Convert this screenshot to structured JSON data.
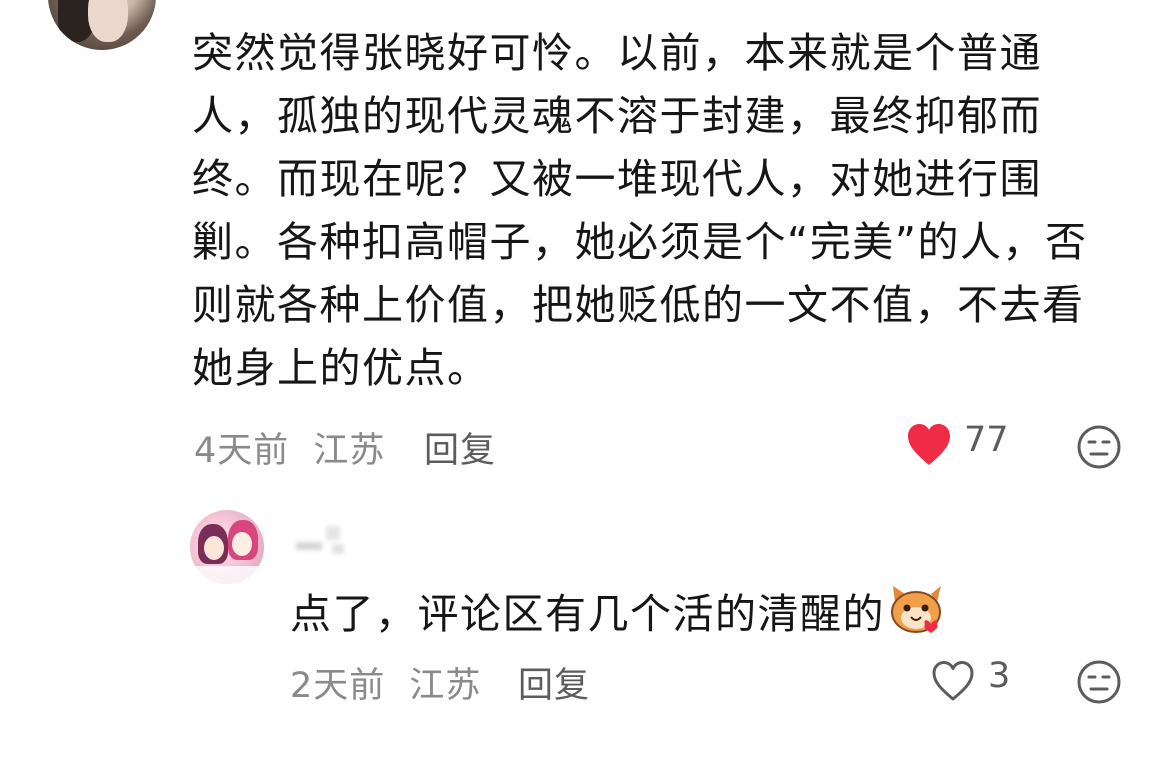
{
  "main_comment": {
    "text": "突然觉得张晓好可怜。以前，本来就是个普通\n人，孤独的现代灵魂不溶于封建，最终抑郁而\n终。而现在呢？又被一堆现代人，对她进行围\n剿。各种扣高帽子，她必须是个“完美”的人，否\n则就各种上价值，把她贬低的一文不值，不去看\n她身上的优点。",
    "time": "4天前",
    "location": "江苏",
    "reply_label": "回复",
    "like_count": "77",
    "liked": true,
    "like_icon": "heart-filled-icon",
    "dislike_icon": "neutral-face-icon"
  },
  "reply_comment": {
    "text": "点了，评论区有几个活的清醒的",
    "emoji": "cat-heart-emoji",
    "time": "2天前",
    "location": "江苏",
    "reply_label": "回复",
    "like_count": "3",
    "liked": false,
    "like_icon": "heart-outline-icon",
    "dislike_icon": "neutral-face-icon"
  },
  "colors": {
    "like_red": "#ef2b45",
    "meta_gray": "#8a8a8a",
    "text_dark": "#161616"
  }
}
